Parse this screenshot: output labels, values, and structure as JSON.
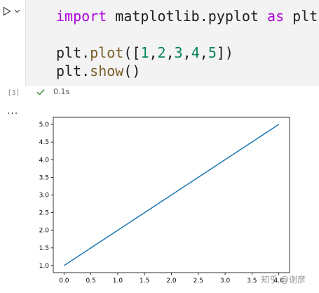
{
  "cell": {
    "run_icon": "play-icon",
    "dropdown_icon": "chevron-down-icon",
    "code": {
      "l1_kw_import": "import",
      "l1_mod": " matplotlib.pyplot ",
      "l1_kw_as": "as",
      "l1_alias": " plt",
      "l3_obj": "plt.",
      "l3_fn": "plot",
      "l3_open": "([",
      "l3_n1": "1",
      "l3_c1": ",",
      "l3_n2": "2",
      "l3_c2": ",",
      "l3_n3": "3",
      "l3_c3": ",",
      "l3_n4": "4",
      "l3_c4": ",",
      "l3_n5": "5",
      "l3_close": "])",
      "l4_obj": "plt.",
      "l4_fn": "show",
      "l4_paren": "()"
    },
    "execution_count": "[3]",
    "status_icon": "check-icon",
    "status_color": "#388a34",
    "exec_time": "0.1s",
    "output_menu": "..."
  },
  "chart_data": {
    "type": "line",
    "x": [
      0,
      1,
      2,
      3,
      4
    ],
    "series": [
      {
        "values": [
          1,
          2,
          3,
          4,
          5
        ]
      }
    ],
    "line_color": "#1f77b4",
    "xlim": [
      -0.2,
      4.2
    ],
    "ylim": [
      0.8,
      5.2
    ],
    "xticks": [
      "0.0",
      "0.5",
      "1.0",
      "1.5",
      "2.0",
      "2.5",
      "3.0",
      "3.5",
      "4.0"
    ],
    "yticks": [
      "1.0",
      "1.5",
      "2.0",
      "2.5",
      "3.0",
      "3.5",
      "4.0",
      "4.5",
      "5.0"
    ],
    "grid": false
  },
  "watermark": "知乎 @谢彦"
}
